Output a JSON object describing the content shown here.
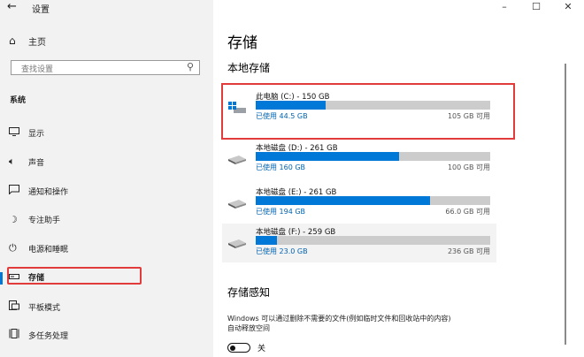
{
  "window": {
    "title": "设置",
    "minimize": "–",
    "maximize": "☐",
    "close": "✕"
  },
  "sidebar": {
    "home_label": "主页",
    "search_placeholder": "查找设置",
    "section_label": "系统",
    "items": [
      {
        "label": "显示",
        "icon": "display-icon"
      },
      {
        "label": "声音",
        "icon": "sound-icon"
      },
      {
        "label": "通知和操作",
        "icon": "notification-icon"
      },
      {
        "label": "专注助手",
        "icon": "focus-assist-icon"
      },
      {
        "label": "电源和睡眠",
        "icon": "power-icon"
      },
      {
        "label": "存储",
        "icon": "storage-icon",
        "selected": true
      },
      {
        "label": "平板模式",
        "icon": "tablet-mode-icon"
      },
      {
        "label": "多任务处理",
        "icon": "multitasking-icon"
      }
    ]
  },
  "main": {
    "title": "存储",
    "local_storage_title": "本地存储",
    "drives": [
      {
        "name": "此电脑 (C:) - 150 GB",
        "used": "已使用 44.5 GB",
        "available": "105 GB 可用",
        "used_fraction": 0.297,
        "icon": "windows-drive-icon"
      },
      {
        "name": "本地磁盘 (D:) - 261 GB",
        "used": "已使用 160 GB",
        "available": "100 GB 可用",
        "used_fraction": 0.613,
        "icon": "drive-icon"
      },
      {
        "name": "本地磁盘 (E:) - 261 GB",
        "used": "已使用 194 GB",
        "available": "66.0 GB 可用",
        "used_fraction": 0.743,
        "icon": "drive-icon"
      },
      {
        "name": "本地磁盘 (F:) - 259 GB",
        "used": "已使用 23.0 GB",
        "available": "236 GB 可用",
        "used_fraction": 0.089,
        "icon": "drive-icon"
      }
    ],
    "storage_sense": {
      "title": "存储感知",
      "desc_line1": "Windows 可以通过删除不需要的文件(例如临时文件和回收站中的内容)",
      "desc_line2": "自动释放空间",
      "toggle_label": "关"
    }
  },
  "colors": {
    "accent": "#0078d7",
    "highlight_box": "#e23b3b",
    "bar_track": "#cccccc"
  }
}
